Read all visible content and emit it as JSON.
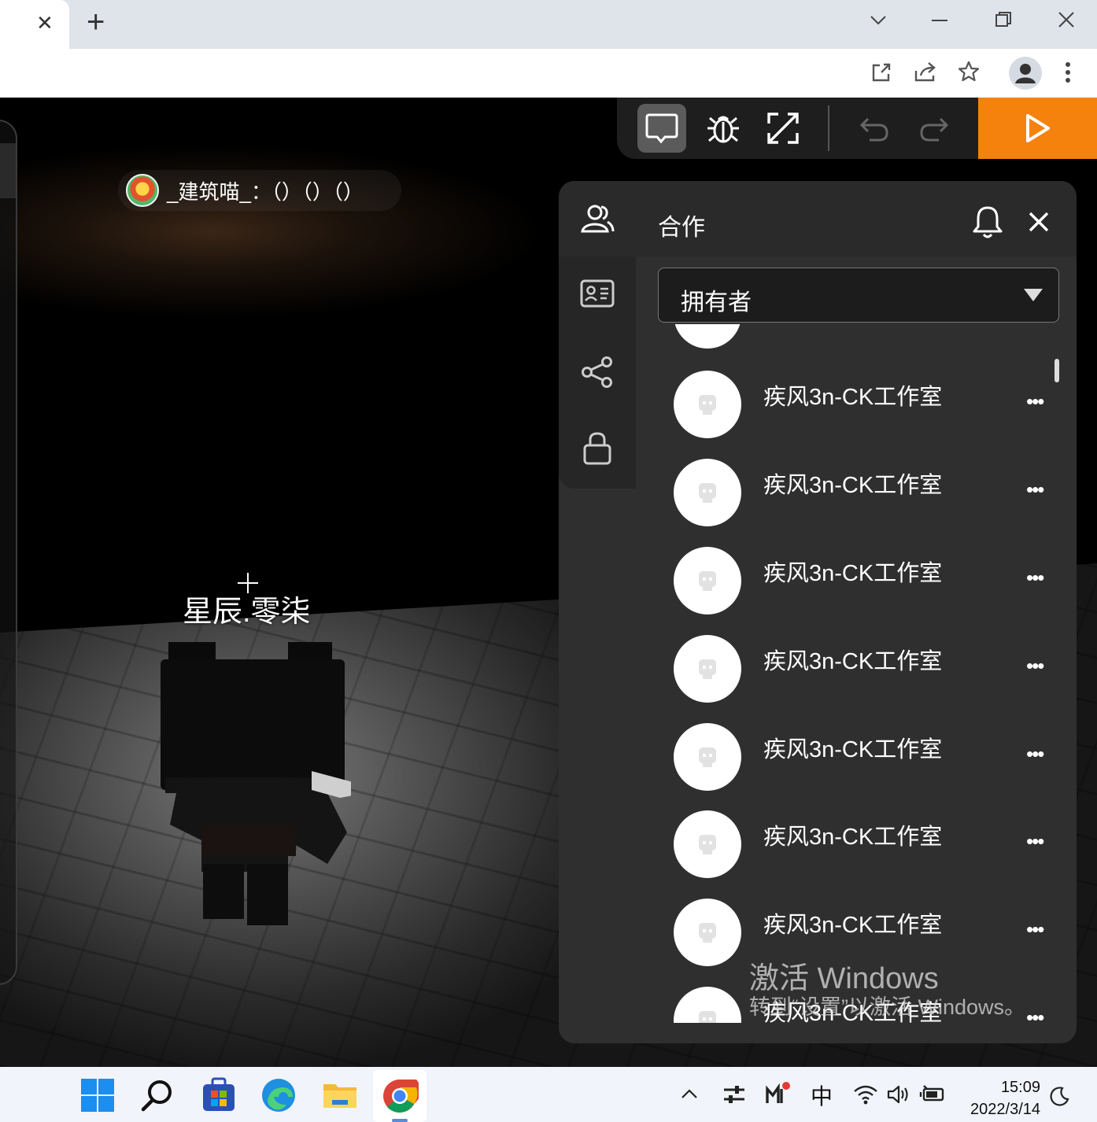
{
  "browser": {
    "tab_close": "✕",
    "new_tab": "+"
  },
  "chat": {
    "user": "_建筑喵_",
    "message": "：（）（）（）"
  },
  "player": {
    "name": "星辰.零柒"
  },
  "panel": {
    "title": "合作",
    "role_select": "拥有者",
    "members": [
      {
        "name": "疾风3n-CK工作室"
      },
      {
        "name": "疾风3n-CK工作室"
      },
      {
        "name": "疾风3n-CK工作室"
      },
      {
        "name": "疾风3n-CK工作室"
      },
      {
        "name": "疾风3n-CK工作室"
      },
      {
        "name": "疾风3n-CK工作室"
      },
      {
        "name": "疾风3n-CK工作室"
      },
      {
        "name": "疾风3n-CK工作室"
      }
    ],
    "more_label": "•••"
  },
  "watermark": {
    "line1": "激活 Windows",
    "line2": "转到“设置”以激活 Windows。"
  },
  "taskbar": {
    "ime": "中",
    "time": "15:09",
    "date": "2022/3/14"
  },
  "colors": {
    "accent": "#f5820c",
    "panel": "#2f2f2f"
  }
}
